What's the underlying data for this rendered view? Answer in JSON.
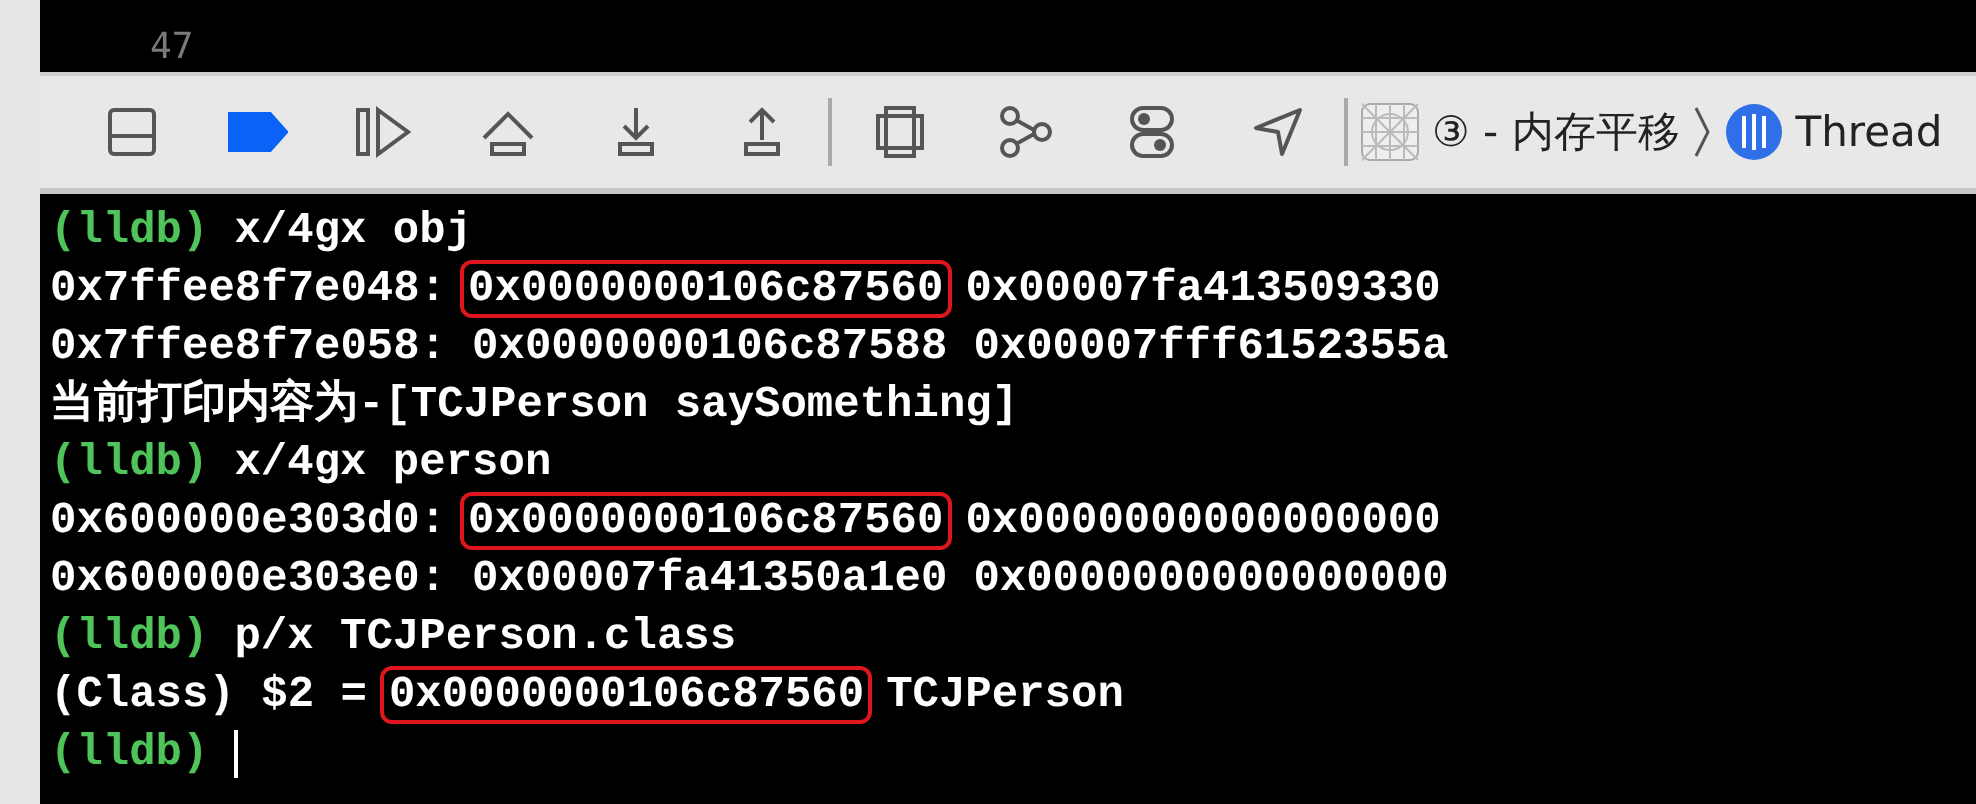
{
  "editor": {
    "line_number": "47"
  },
  "toolbar": {
    "breakpoints_active": true,
    "breadcrumb": [
      {
        "kind": "scheme",
        "text": "③ - 内存平移"
      },
      {
        "kind": "thread",
        "text": "Thread"
      }
    ]
  },
  "console": {
    "lines": [
      {
        "kind": "command",
        "prompt": "(lldb)",
        "command": "x/4gx obj",
        "cursor": false
      },
      {
        "kind": "output",
        "parts": [
          {
            "text": "0x7ffee8f7e048:",
            "highlighted": false
          },
          {
            "text": "0x0000000106c87560",
            "highlighted": true
          },
          {
            "text": "0x00007fa413509330",
            "highlighted": false
          }
        ]
      },
      {
        "kind": "output",
        "parts": [
          {
            "text": "0x7ffee8f7e058:",
            "highlighted": false
          },
          {
            "text": "0x0000000106c87588",
            "highlighted": false
          },
          {
            "text": "0x00007fff6152355a",
            "highlighted": false
          }
        ]
      },
      {
        "kind": "output",
        "parts": [
          {
            "text": "当前打印内容为-[TCJPerson saySomething]",
            "highlighted": false
          }
        ]
      },
      {
        "kind": "command",
        "prompt": "(lldb)",
        "command": "x/4gx person",
        "cursor": false
      },
      {
        "kind": "output",
        "parts": [
          {
            "text": "0x600000e303d0:",
            "highlighted": false
          },
          {
            "text": "0x0000000106c87560",
            "highlighted": true
          },
          {
            "text": "0x0000000000000000",
            "highlighted": false
          }
        ]
      },
      {
        "kind": "output",
        "parts": [
          {
            "text": "0x600000e303e0:",
            "highlighted": false
          },
          {
            "text": "0x00007fa41350a1e0",
            "highlighted": false
          },
          {
            "text": "0x0000000000000000",
            "highlighted": false
          }
        ]
      },
      {
        "kind": "command",
        "prompt": "(lldb)",
        "command": "p/x TCJPerson.class",
        "cursor": false
      },
      {
        "kind": "output",
        "parts": [
          {
            "text": "(Class) $2 =",
            "highlighted": false
          },
          {
            "text": "0x0000000106c87560",
            "highlighted": true
          },
          {
            "text": "TCJPerson",
            "highlighted": false
          }
        ]
      },
      {
        "kind": "command",
        "prompt": "(lldb)",
        "cursor": true
      }
    ]
  }
}
